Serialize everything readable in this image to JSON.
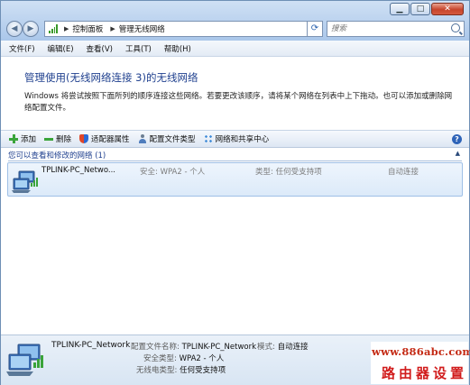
{
  "window": {
    "minimize": "▁",
    "maximize": "□",
    "close": "✕"
  },
  "nav": {
    "back_icon": "back-arrow-icon",
    "forward_icon": "forward-arrow-icon"
  },
  "address": {
    "crumbs": [
      "控制面板",
      "管理无线网络"
    ]
  },
  "search": {
    "placeholder": "搜索"
  },
  "menu": [
    "文件(F)",
    "编辑(E)",
    "查看(V)",
    "工具(T)",
    "帮助(H)"
  ],
  "page": {
    "title": "管理使用(无线网络连接 3)的无线网络",
    "description": "Windows 将尝试按照下面所列的顺序连接这些网络。若要更改该顺序，请将某个网络在列表中上下拖动。也可以添加或删除网络配置文件。"
  },
  "toolbar": {
    "add": "添加",
    "remove": "删除",
    "adapter": "适配器属性",
    "profile_types": "配置文件类型",
    "network_center": "网络和共享中心"
  },
  "group": {
    "title": "您可以查看和修改的网络 (1)"
  },
  "networks": [
    {
      "name": "TPLINK-PC_Netwo...",
      "security": "安全: WPA2 - 个人",
      "type": "类型: 任何受支持项",
      "mode": "自动连接"
    }
  ],
  "details": {
    "name": "TPLINK-PC_Network",
    "profile_label": "配置文件名称:",
    "profile_value": "TPLINK-PC_Network",
    "mode_label": "模式:",
    "mode_value": "自动连接",
    "security_label": "安全类型:",
    "security_value": "WPA2 - 个人",
    "radio_label": "无线电类型:",
    "radio_value": "任何受支持项"
  },
  "watermark": {
    "url": "www.886abc.com",
    "text": "路由器设置"
  },
  "colors": {
    "accent": "#1e3f8e",
    "row_bg": "#dceaf9",
    "watermark": "#c42a14"
  }
}
